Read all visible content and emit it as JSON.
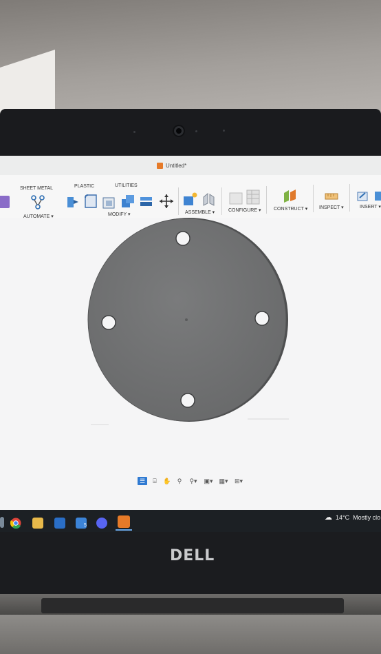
{
  "app": {
    "document_title": "Untitled*"
  },
  "toolbar": {
    "tabs": [
      "SHEET METAL",
      "PLASTIC",
      "UTILITIES"
    ],
    "groups": {
      "automate": "AUTOMATE ▾",
      "modify": "MODIFY ▾",
      "assemble": "ASSEMBLE ▾",
      "configure": "CONFIGURE ▾",
      "construct": "CONSTRUCT ▾",
      "inspect": "INSPECT ▾",
      "insert": "INSERT ▾"
    }
  },
  "navbar": {
    "items": [
      {
        "icon": "orbit-icon",
        "glyph": "☰"
      },
      {
        "icon": "look-at-icon",
        "glyph": "⌸"
      },
      {
        "icon": "pan-icon",
        "glyph": "✋"
      },
      {
        "icon": "zoom-icon",
        "glyph": "⚲"
      },
      {
        "icon": "zoom-window-icon",
        "glyph": "⚲▾"
      },
      {
        "icon": "display-settings-icon",
        "glyph": "▣▾"
      },
      {
        "icon": "grid-icon",
        "glyph": "▦▾"
      },
      {
        "icon": "viewports-icon",
        "glyph": "⊞▾"
      }
    ]
  },
  "taskbar": {
    "badge_count": "5",
    "weather": "14°C",
    "weather_desc": "Mostly clo"
  },
  "hardware": {
    "brand": "DELL"
  },
  "colors": {
    "accent": "#2f7ad2",
    "part_face": "#737475",
    "part_edge": "#505152",
    "fusion_orange": "#e67a28"
  }
}
